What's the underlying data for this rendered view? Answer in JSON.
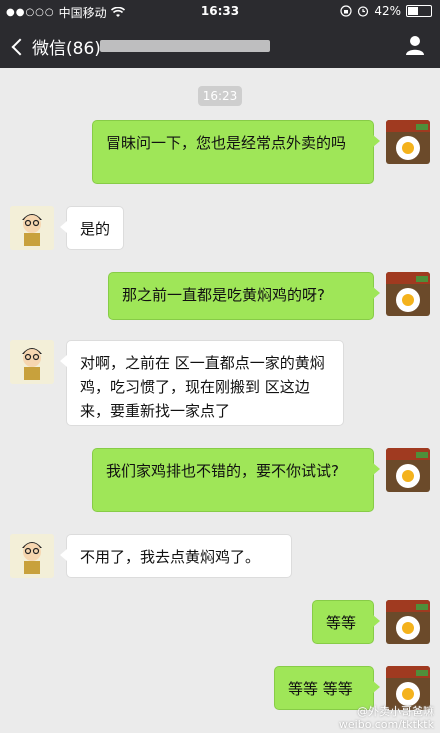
{
  "status_bar": {
    "carrier": "中国移动",
    "time": "16:33",
    "battery": "42%",
    "battery_level": 0.42
  },
  "nav": {
    "back_label": "微信(86)"
  },
  "chat": {
    "timestamp": "16:23",
    "messages": [
      {
        "from": "me",
        "text": "冒昧问一下，您也是经常点外卖的吗"
      },
      {
        "from": "them",
        "text": "是的"
      },
      {
        "from": "me",
        "text": "那之前一直都是吃黄焖鸡的呀?"
      },
      {
        "from": "them",
        "text": "对啊，之前在  区一直都点一家的黄焖鸡，吃习惯了，现在刚搬到  区这边来，要重新找一家点了"
      },
      {
        "from": "me",
        "text": "我们家鸡排也不错的，要不你试试?"
      },
      {
        "from": "them",
        "text": "不用了，我去点黄焖鸡了。"
      },
      {
        "from": "me",
        "text": "等等"
      },
      {
        "from": "me",
        "text": "等等 等等"
      }
    ]
  },
  "watermark": {
    "line1": "@外卖小哥爸嘛",
    "line2": "weibo.com/tktktk"
  },
  "colors": {
    "bar": "#2b2b2f",
    "bg": "#ebebeb",
    "me_bubble": "#9fe658",
    "them_bubble": "#ffffff"
  }
}
